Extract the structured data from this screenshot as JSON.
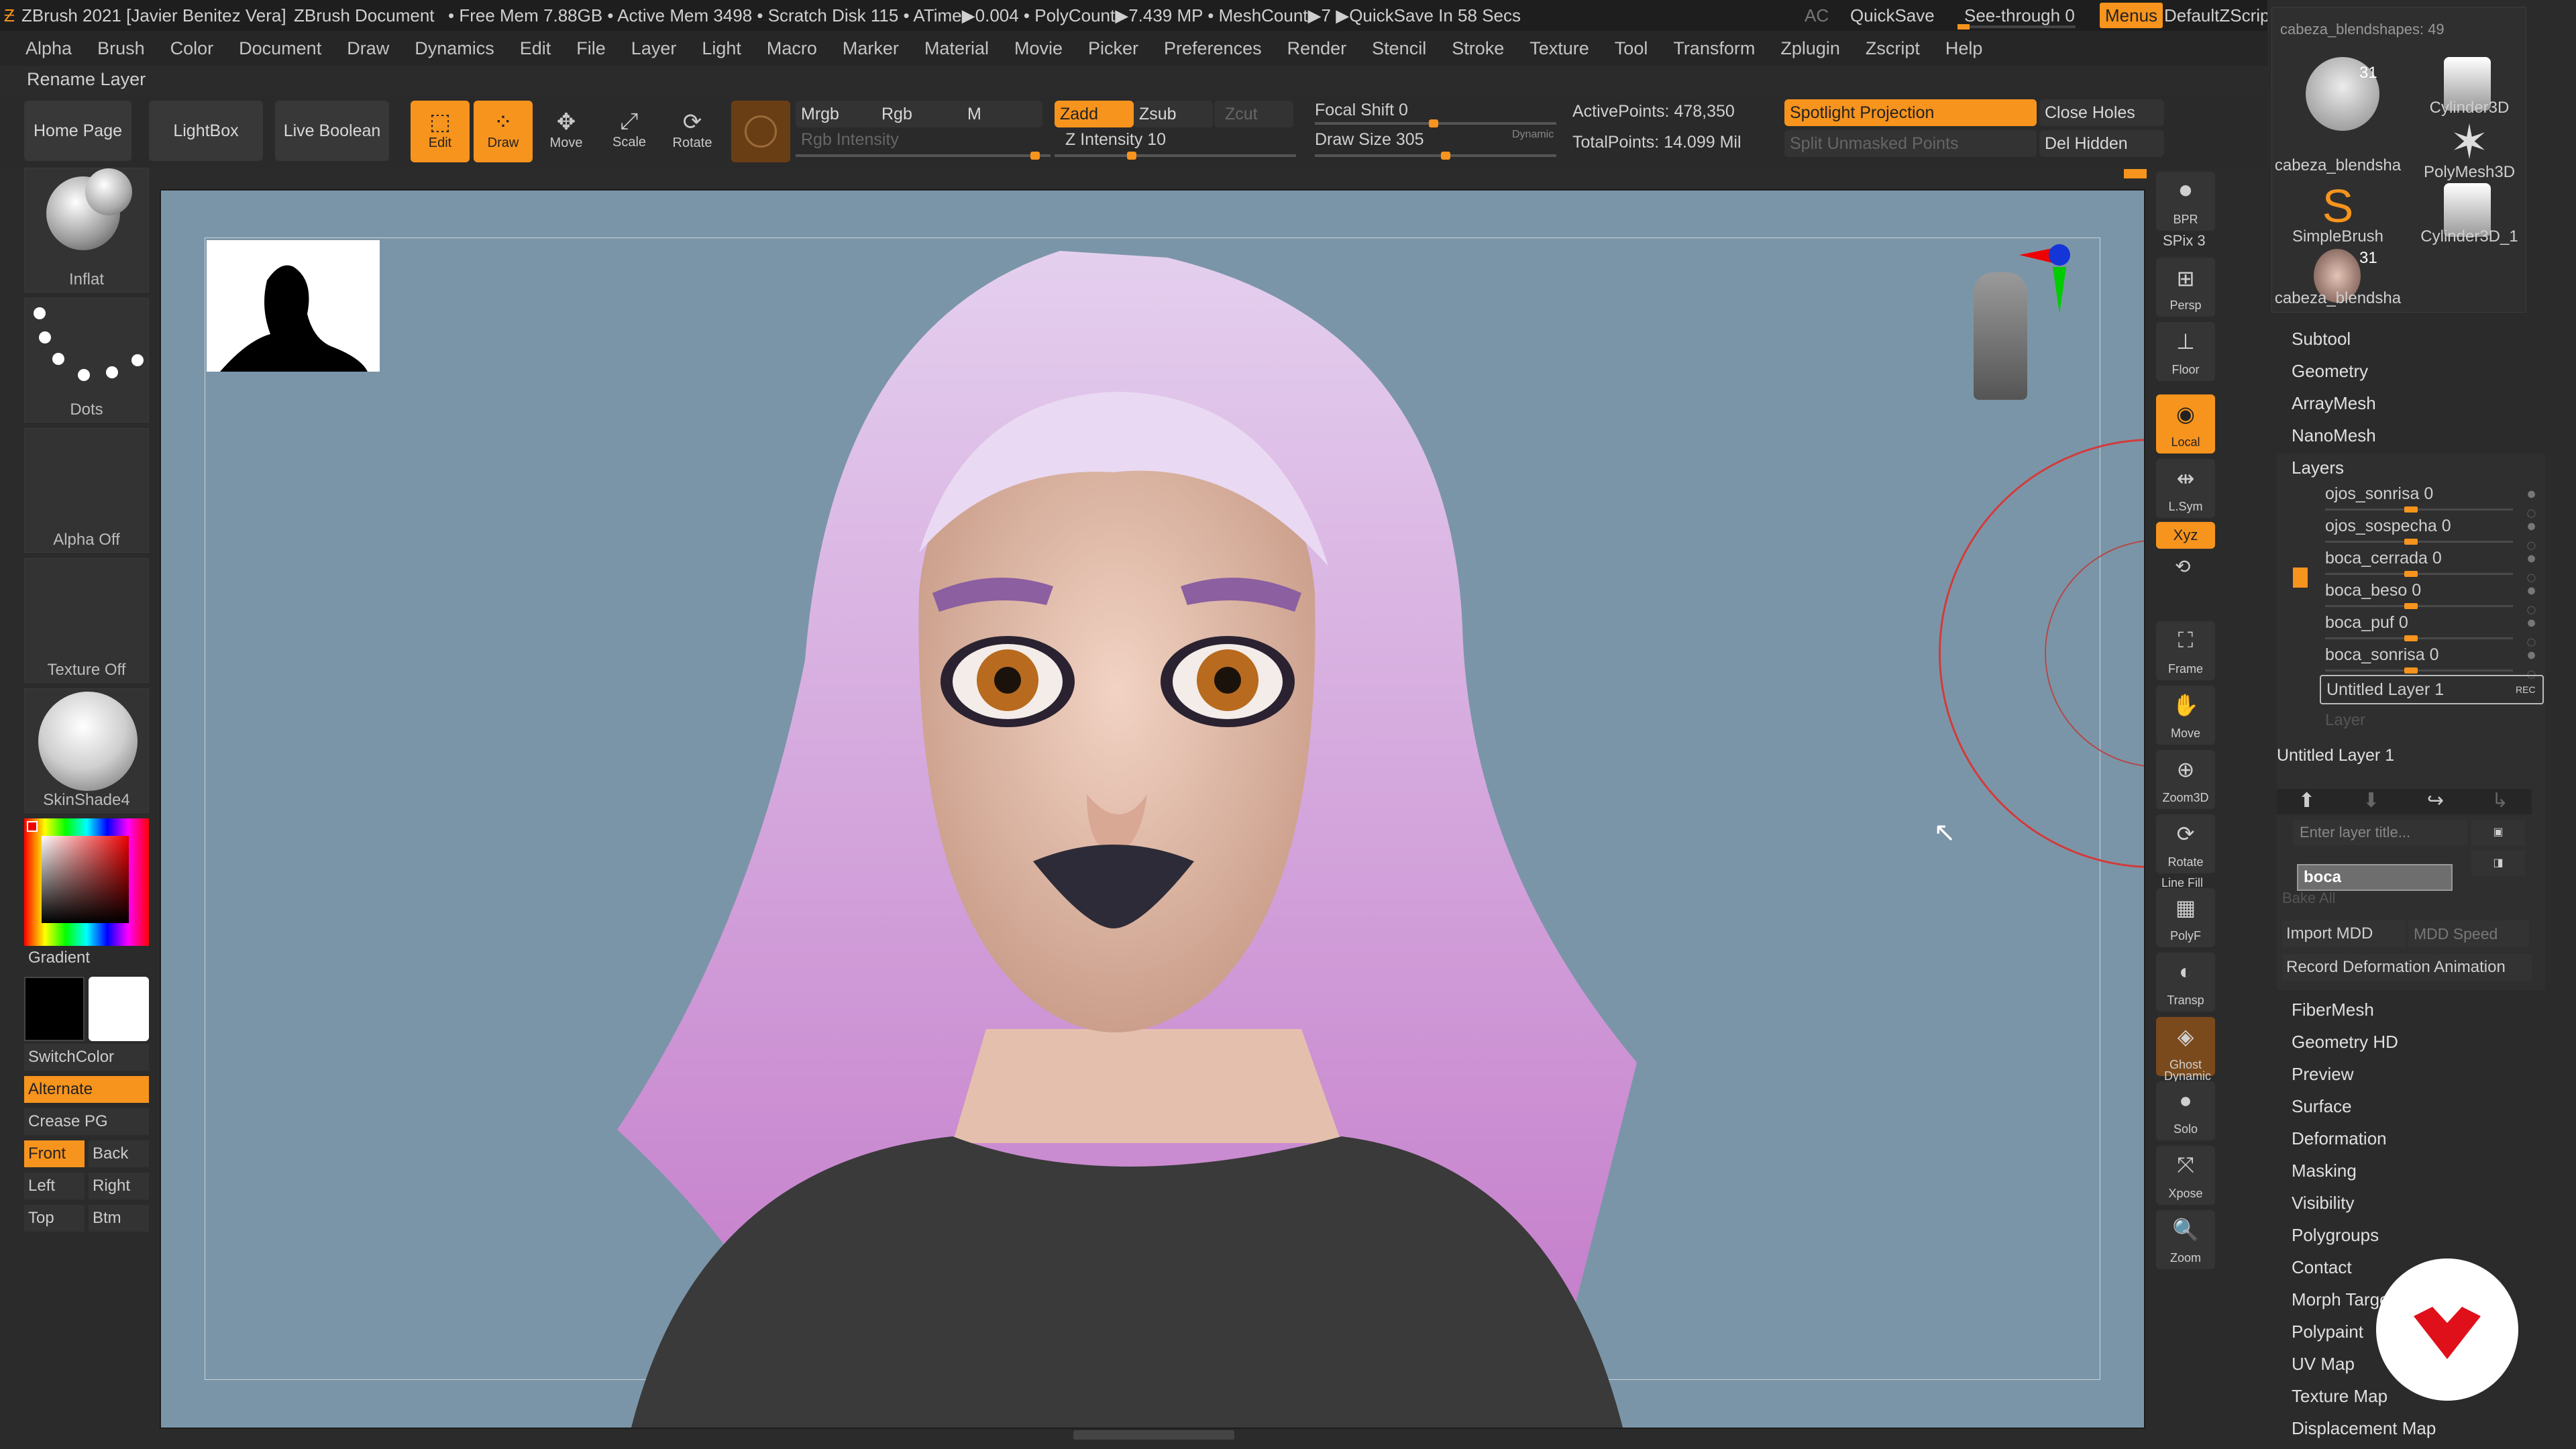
{
  "title_bar": {
    "app": "ZBrush 2021 [Javier Benitez Vera]",
    "doc": "ZBrush Document",
    "stats": "• Free Mem 7.88GB • Active Mem 3498 • Scratch Disk 115 • ATime▶0.004 • PolyCount▶7.439 MP • MeshCount▶7 ▶QuickSave In 58 Secs",
    "ac": "AC",
    "quicksave": "QuickSave",
    "see_through": "See-through 0",
    "menus": "Menus",
    "script": "DefaultZScript"
  },
  "menu": [
    "Alpha",
    "Brush",
    "Color",
    "Document",
    "Draw",
    "Dynamics",
    "Edit",
    "File",
    "Layer",
    "Light",
    "Macro",
    "Marker",
    "Material",
    "Movie",
    "Picker",
    "Preferences",
    "Render",
    "Stencil",
    "Stroke",
    "Texture",
    "Tool",
    "Transform",
    "Zplugin",
    "Zscript",
    "Help"
  ],
  "rename_layer": "Rename Layer",
  "toolbar": {
    "home": "Home Page",
    "lightbox": "LightBox",
    "live_boolean": "Live Boolean",
    "edit": "Edit",
    "draw": "Draw",
    "move": "Move",
    "scale": "Scale",
    "rotate": "Rotate",
    "mrgb": "Mrgb",
    "rgb": "Rgb",
    "m": "M",
    "rgb_intensity": "Rgb Intensity",
    "zadd": "Zadd",
    "zsub": "Zsub",
    "zcut": "Zcut",
    "z_intensity": "Z Intensity 10",
    "focal_shift": "Focal Shift 0",
    "draw_size": "Draw Size 305",
    "dynamic": "Dynamic",
    "active_points": "ActivePoints: 478,350",
    "total_points": "TotalPoints: 14.099 Mil",
    "spotlight": "Spotlight Projection",
    "split_unmasked": "Split Unmasked Points",
    "close_holes": "Close Holes",
    "del_hidden": "Del Hidden"
  },
  "left": {
    "brush": "Inflat",
    "stroke": "Dots",
    "alpha": "Alpha Off",
    "texture": "Texture Off",
    "material": "SkinShade4",
    "gradient": "Gradient",
    "switch_color": "SwitchColor",
    "alternate": "Alternate",
    "crease_pg": "Crease PG",
    "front": "Front",
    "back": "Back",
    "left": "Left",
    "right": "Right",
    "top": "Top",
    "btm": "Btm"
  },
  "right_shelf": {
    "bpr": "BPR",
    "spix": "SPix 3",
    "persp": "Persp",
    "floor": "Floor",
    "local": "Local",
    "lsym": "L.Sym",
    "xyz": "Xyz",
    "frame": "Frame",
    "move": "Move",
    "zoom3d": "Zoom3D",
    "rotate": "Rotate",
    "linefill": "Line Fill",
    "polyf": "PolyF",
    "transp": "Transp",
    "ghost": "Ghost",
    "dynamic": "Dynamic",
    "solo": "Solo",
    "xpose": "Xpose",
    "zoom": "Zoom"
  },
  "tools": {
    "top": "cabeza_blendshapes: 49",
    "t1": "cabeza_blendsha",
    "t1n": "31",
    "t2": "Cylinder3D",
    "t3": "PolyMesh3D",
    "t4": "SimpleBrush",
    "t5": "Cylinder3D_1",
    "t6": "cabeza_blendsha",
    "t6n": "31"
  },
  "palette": {
    "subtool": "Subtool",
    "geometry": "Geometry",
    "arraymesh": "ArrayMesh",
    "nanomesh": "NanoMesh",
    "layers": "Layers",
    "layer_list": [
      {
        "name": "ojos_sonrisa",
        "v": "0"
      },
      {
        "name": "ojos_sospecha",
        "v": "0"
      },
      {
        "name": "boca_cerrada",
        "v": "0"
      },
      {
        "name": "boca_beso",
        "v": "0"
      },
      {
        "name": "boca_puf",
        "v": "0"
      },
      {
        "name": "boca_sonrisa",
        "v": "0"
      }
    ],
    "untitled": "Untitled Layer 1",
    "rec": "REC",
    "layer_ph": "Layer",
    "untitled2": "Untitled Layer 1",
    "enter_title": "Enter layer title...",
    "input_value": "boca",
    "bake_all": "Bake All",
    "import_mdd": "Import MDD",
    "mdd_speed": "MDD Speed",
    "record": "Record Deformation Animation",
    "sections": [
      "FiberMesh",
      "Geometry HD",
      "Preview",
      "Surface",
      "Deformation",
      "Masking",
      "Visibility",
      "Polygroups",
      "Contact",
      "Morph Target",
      "Polypaint",
      "UV Map",
      "Texture Map",
      "Displacement Map"
    ]
  }
}
